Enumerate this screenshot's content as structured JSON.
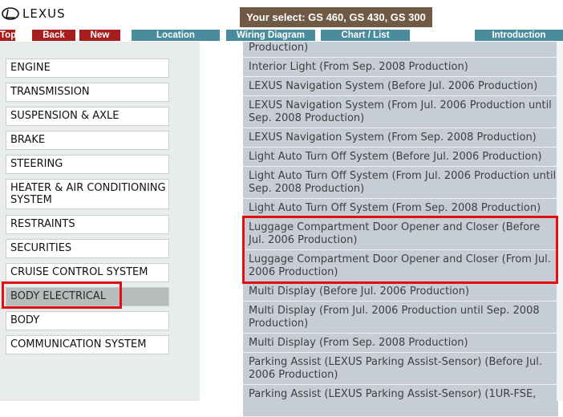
{
  "header": {
    "logo_text": "LEXUS",
    "select_banner": "Your select: GS 460, GS 430, GS 300"
  },
  "nav": {
    "top": "Top",
    "back": "Back",
    "new": "New",
    "location": "Location",
    "wiring_diagram": "Wiring Diagram",
    "chart_list": "Chart / List",
    "introduction": "Introduction"
  },
  "categories": [
    "ENGINE",
    "TRANSMISSION",
    "SUSPENSION & AXLE",
    "BRAKE",
    "STEERING",
    "HEATER & AIR CONDITIONING SYSTEM",
    "RESTRAINTS",
    "SECURITIES",
    "CRUISE CONTROL SYSTEM",
    "BODY ELECTRICAL",
    "BODY",
    "COMMUNICATION SYSTEM"
  ],
  "active_category": "BODY ELECTRICAL",
  "items": [
    "Production)",
    "Interior Light (From Sep. 2008 Production)",
    "LEXUS Navigation System (Before Jul. 2006 Production)",
    "LEXUS Navigation System (From Jul. 2006 Production until Sep. 2008 Production)",
    "LEXUS Navigation System (From Sep. 2008 Production)",
    "Light Auto Turn Off System (Before Jul. 2006 Production)",
    "Light Auto Turn Off System (From Jul. 2006 Production until Sep. 2008 Production)",
    "Light Auto Turn Off System (From Sep. 2008 Production)",
    "Luggage Compartment Door Opener and Closer (Before Jul. 2006 Production)",
    "Luggage Compartment Door Opener and Closer (From Jul. 2006 Production)",
    "Multi Display (Before Jul. 2006 Production)",
    "Multi Display (From Jul. 2006 Production until Sep. 2008 Production)",
    "Multi Display (From Sep. 2008 Production)",
    "Parking Assist (LEXUS Parking Assist-Sensor) (Before Jul. 2006 Production)",
    "Parking Assist (LEXUS Parking Assist-Sensor) (1UR-FSE,"
  ],
  "colors": {
    "nav_red": "#a81e1e",
    "nav_teal": "#4a8c9c",
    "banner": "#705a45",
    "item_bg": "#c7cdd6",
    "highlight": "#e01010"
  }
}
